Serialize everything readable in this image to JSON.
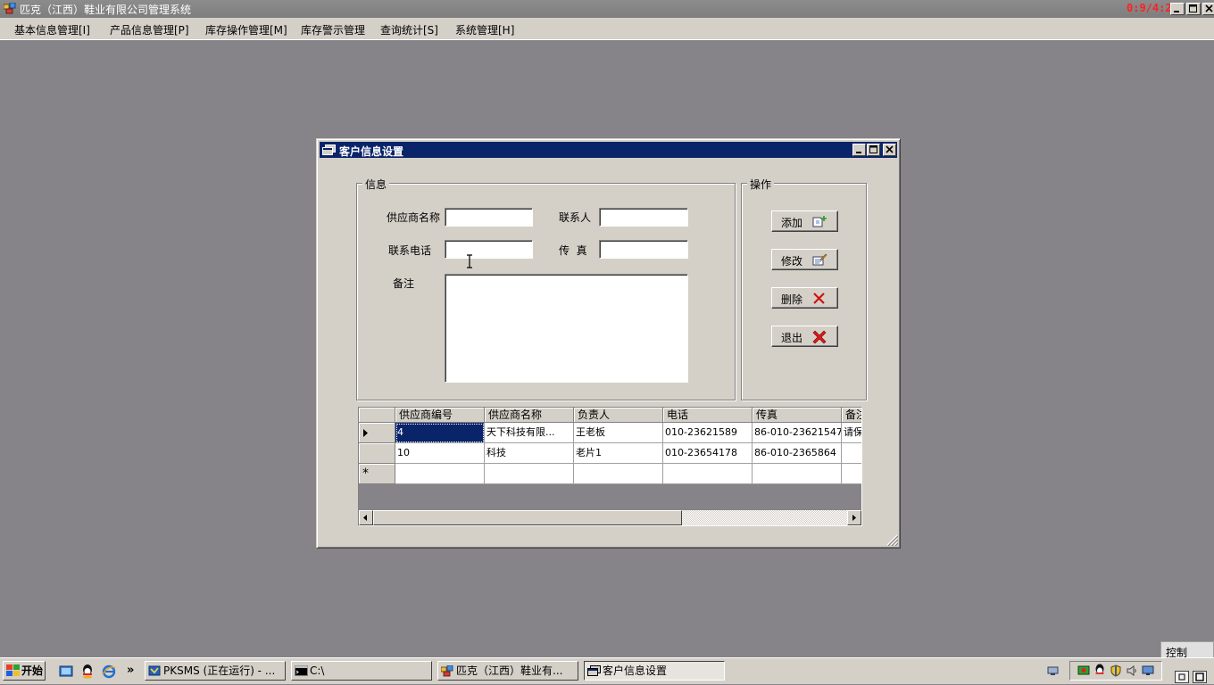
{
  "app": {
    "title": "匹克（江西）鞋业有限公司管理系统",
    "timer": "0:9/4:24"
  },
  "menu": [
    {
      "label": "基本信息管理[I]"
    },
    {
      "label": "产品信息管理[P]"
    },
    {
      "label": "库存操作管理[M]"
    },
    {
      "label": "库存警示管理"
    },
    {
      "label": "查询统计[S]"
    },
    {
      "label": "系统管理[H]"
    }
  ],
  "dialog": {
    "title": "客户信息设置",
    "info_group": "信息",
    "ops_group": "操作",
    "fields": {
      "supplier_name_label": "供应商名称",
      "contact_label": "联系人",
      "phone_label": "联系电话",
      "fax_label": "传  真",
      "remark_label": "备注",
      "supplier_name_value": "",
      "contact_value": "",
      "phone_value": "",
      "fax_value": "",
      "remark_value": ""
    },
    "buttons": {
      "add": "添加",
      "edit": "修改",
      "delete": "删除",
      "exit": "退出"
    }
  },
  "grid": {
    "columns": [
      "供应商编号",
      "供应商名称",
      "负责人",
      "电话",
      "传真",
      "备注"
    ],
    "rows": [
      [
        "4",
        "天下科技有限...",
        "王老板",
        "010-23621589",
        "86-010-23621547",
        "请保"
      ],
      [
        "10",
        "科技",
        "老片1",
        "010-23654178",
        "86-010-2365864",
        ""
      ]
    ],
    "new_row_marker": "*"
  },
  "taskbar": {
    "start": "开始",
    "more": "»",
    "tasks": [
      {
        "label": "PKSMS (正在运行) - ..."
      },
      {
        "label": "C:\\"
      },
      {
        "label": "匹克（江西）鞋业有..."
      },
      {
        "label": "客户信息设置"
      }
    ],
    "control_label": "控制"
  }
}
